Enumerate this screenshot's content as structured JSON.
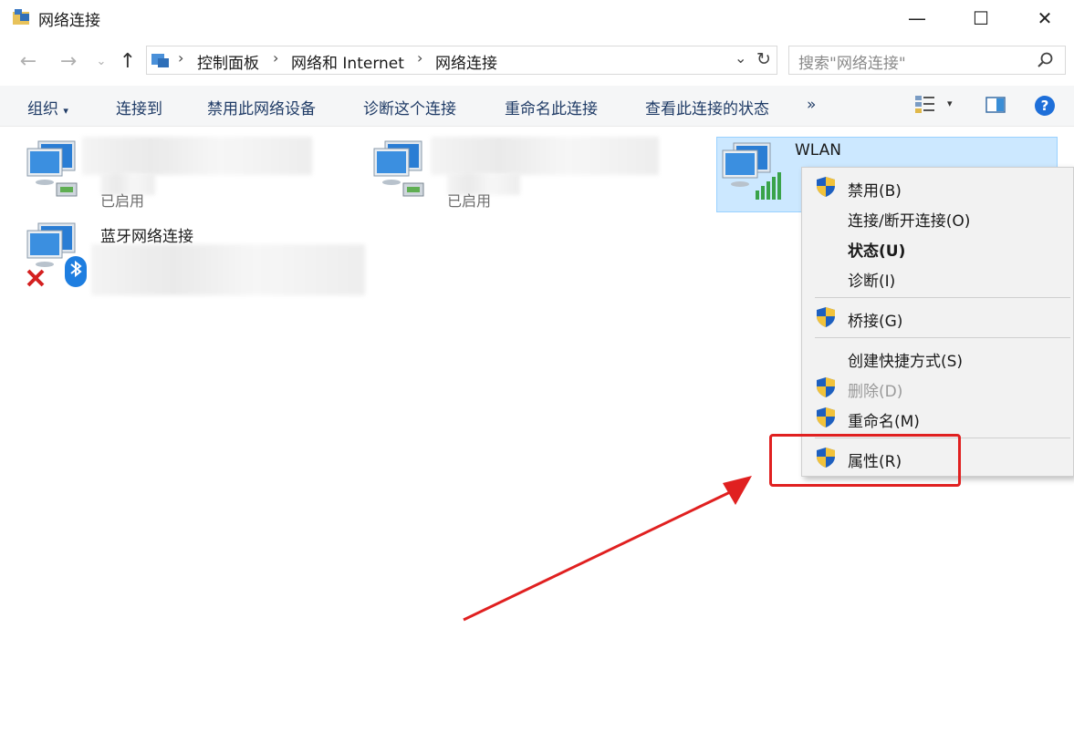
{
  "window": {
    "title": "网络连接",
    "minimize_glyph": "—",
    "maximize_glyph": "☐",
    "close_glyph": "✕"
  },
  "address": {
    "crumbs": [
      "控制面板",
      "网络和 Internet",
      "网络连接"
    ],
    "search_placeholder": "搜索\"网络连接\""
  },
  "toolbar": {
    "organize": "组织",
    "connect_to": "连接到",
    "disable": "禁用此网络设备",
    "diagnose": "诊断这个连接",
    "rename": "重命名此连接",
    "view_status": "查看此连接的状态",
    "more": "»"
  },
  "connections": [
    {
      "name": "",
      "status": "已启用",
      "type": "ethernet"
    },
    {
      "name": "",
      "status": "已启用",
      "type": "ethernet"
    },
    {
      "name": "WLAN",
      "status": "",
      "type": "wifi"
    },
    {
      "name": "蓝牙网络连接",
      "status": "",
      "type": "bluetooth"
    }
  ],
  "context_menu": {
    "items": [
      {
        "label": "禁用(B)",
        "shield": true,
        "bold": false,
        "disabled": false
      },
      {
        "label": "连接/断开连接(O)",
        "shield": false,
        "bold": false,
        "disabled": false
      },
      {
        "label": "状态(U)",
        "shield": false,
        "bold": true,
        "disabled": false
      },
      {
        "label": "诊断(I)",
        "shield": false,
        "bold": false,
        "disabled": false
      },
      {
        "label": "桥接(G)",
        "shield": true,
        "bold": false,
        "disabled": false
      },
      {
        "label": "创建快捷方式(S)",
        "shield": false,
        "bold": false,
        "disabled": false
      },
      {
        "label": "删除(D)",
        "shield": true,
        "bold": false,
        "disabled": true
      },
      {
        "label": "重命名(M)",
        "shield": true,
        "bold": false,
        "disabled": false
      },
      {
        "label": "属性(R)",
        "shield": true,
        "bold": false,
        "disabled": false
      }
    ]
  },
  "colors": {
    "selection": "#cce8ff",
    "annotation": "#e02020",
    "command_text": "#1f3b66"
  }
}
